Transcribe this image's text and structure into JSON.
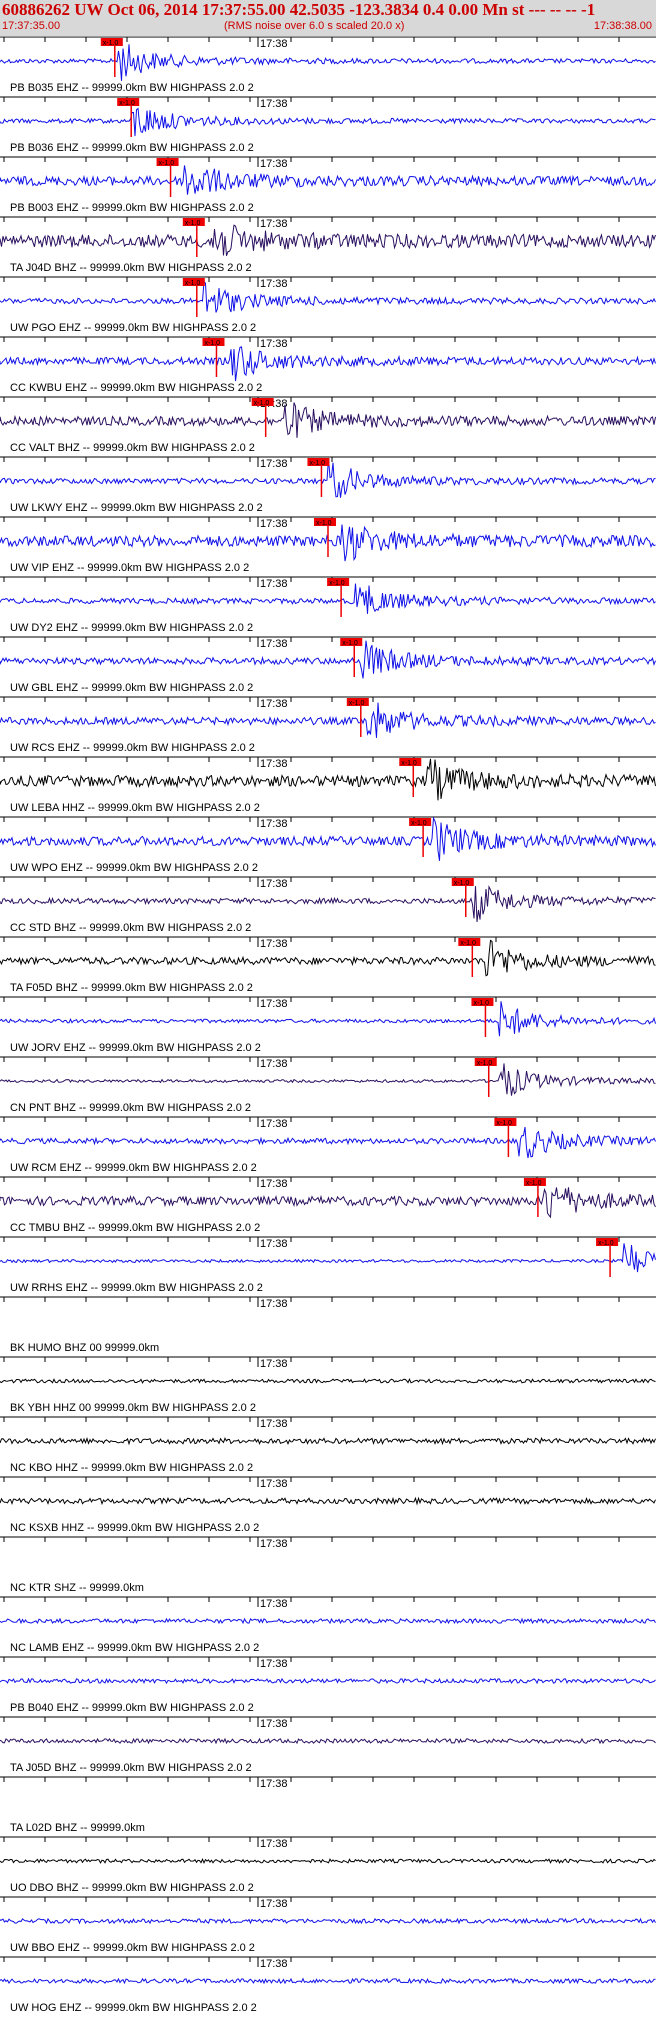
{
  "header": {
    "title": "60886262 UW Oct 06, 2014 17:37:55.00   42.5035 -123.3834  0.4 0.00 Mn st --- -- --  -1",
    "start_time": "17:37:35.00",
    "scale_note": "(RMS noise over 6.0 s scaled 20.0 x)",
    "end_time": "17:38:38.00"
  },
  "tick_label": "17:38",
  "pick_label": "x-1.0",
  "colors": {
    "header_bg": "#d8d8d8",
    "header_text": "#cc0000",
    "pick": "#ee0000",
    "blue": "#1010e8",
    "dark": "#2a1060",
    "black": "#000000"
  },
  "traces": [
    {
      "label": "PB B035 EHZ -- 99999.0km BW  HIGHPASS  2.0  2",
      "color": "blue",
      "amp": 0.12,
      "pick": 0.175,
      "event": 0.18
    },
    {
      "label": "PB B036 EHZ -- 99999.0km BW  HIGHPASS  2.0  2",
      "color": "blue",
      "amp": 0.12,
      "pick": 0.2,
      "event": 0.2
    },
    {
      "label": "PB B003 EHZ -- 99999.0km BW  HIGHPASS  2.0  2",
      "color": "blue",
      "amp": 0.25,
      "pick": 0.26,
      "event": 0.28
    },
    {
      "label": "TA J04D BHZ -- 99999.0km BW  HIGHPASS  2.0  2",
      "color": "dark",
      "amp": 0.35,
      "pick": 0.3,
      "event": 0.32
    },
    {
      "label": "UW PGO EHZ -- 99999.0km BW  HIGHPASS  2.0  2",
      "color": "blue",
      "amp": 0.15,
      "pick": 0.3,
      "event": 0.31
    },
    {
      "label": "CC KWBU EHZ -- 99999.0km BW  HIGHPASS  2.0  2",
      "color": "blue",
      "amp": 0.2,
      "pick": 0.33,
      "event": 0.35
    },
    {
      "label": "CC VALT BHZ -- 99999.0km BW  HIGHPASS  2.0  2",
      "color": "dark",
      "amp": 0.25,
      "pick": 0.405,
      "event": 0.43
    },
    {
      "label": "UW LKWY EHZ -- 99999.0km BW  HIGHPASS  2.0  2",
      "color": "blue",
      "amp": 0.15,
      "pick": 0.49,
      "event": 0.5
    },
    {
      "label": "UW VIP EHZ -- 99999.0km BW  HIGHPASS  2.0  2",
      "color": "blue",
      "amp": 0.3,
      "pick": 0.5,
      "event": 0.52
    },
    {
      "label": "UW DY2 EHZ -- 99999.0km BW  HIGHPASS  2.0  2",
      "color": "blue",
      "amp": 0.15,
      "pick": 0.52,
      "event": 0.54
    },
    {
      "label": "UW GBL EHZ -- 99999.0km BW  HIGHPASS  2.0  2",
      "color": "blue",
      "amp": 0.18,
      "pick": 0.54,
      "event": 0.55
    },
    {
      "label": "UW RCS EHZ -- 99999.0km BW  HIGHPASS  2.0  2",
      "color": "blue",
      "amp": 0.2,
      "pick": 0.55,
      "event": 0.56
    },
    {
      "label": "UW LEBA HHZ -- 99999.0km BW  HIGHPASS  2.0  2",
      "color": "black",
      "amp": 0.3,
      "pick": 0.63,
      "event": 0.65
    },
    {
      "label": "UW WPO EHZ -- 99999.0km BW  HIGHPASS  2.0  2",
      "color": "blue",
      "amp": 0.25,
      "pick": 0.645,
      "event": 0.66
    },
    {
      "label": "CC STD BHZ -- 99999.0km BW  HIGHPASS  2.0  2",
      "color": "dark",
      "amp": 0.15,
      "pick": 0.71,
      "event": 0.72
    },
    {
      "label": "TA F05D BHZ -- 99999.0km BW  HIGHPASS  2.0  2",
      "color": "black",
      "amp": 0.2,
      "pick": 0.72,
      "event": 0.74
    },
    {
      "label": "UW JORV EHZ -- 99999.0km BW  HIGHPASS  2.0  2",
      "color": "blue",
      "amp": 0.1,
      "pick": 0.74,
      "event": 0.76
    },
    {
      "label": "CN PNT BHZ -- 99999.0km BW  HIGHPASS  2.0  2",
      "color": "dark",
      "amp": 0.08,
      "pick": 0.745,
      "event": 0.76
    },
    {
      "label": "UW RCM EHZ -- 99999.0km BW  HIGHPASS  2.0  2",
      "color": "blue",
      "amp": 0.15,
      "pick": 0.775,
      "event": 0.79
    },
    {
      "label": "CC TMBU BHZ -- 99999.0km BW  HIGHPASS  2.0  2",
      "color": "dark",
      "amp": 0.25,
      "pick": 0.82,
      "event": 0.83
    },
    {
      "label": "UW RRHS EHZ -- 99999.0km BW  HIGHPASS  2.0  2",
      "color": "blue",
      "amp": 0.08,
      "pick": 0.93,
      "event": 0.95
    },
    {
      "label": "BK HUMO BHZ 00 99999.0km",
      "color": "none",
      "amp": 0,
      "pick": null,
      "event": null
    },
    {
      "label": "BK YBH HHZ 00 99999.0km BW  HIGHPASS  2.0  2",
      "color": "black",
      "amp": 0.1,
      "pick": null,
      "event": null
    },
    {
      "label": "NC KBO HHZ -- 99999.0km BW  HIGHPASS  2.0  2",
      "color": "black",
      "amp": 0.15,
      "pick": null,
      "event": null
    },
    {
      "label": "NC KSXB HHZ -- 99999.0km BW  HIGHPASS  2.0  2",
      "color": "black",
      "amp": 0.15,
      "pick": null,
      "event": null
    },
    {
      "label": "NC KTR SHZ -- 99999.0km",
      "color": "none",
      "amp": 0,
      "pick": null,
      "event": null
    },
    {
      "label": "NC LAMB EHZ -- 99999.0km BW  HIGHPASS  2.0  2",
      "color": "blue",
      "amp": 0.12,
      "pick": null,
      "event": null
    },
    {
      "label": "PB B040 EHZ -- 99999.0km BW  HIGHPASS  2.0  2",
      "color": "blue",
      "amp": 0.12,
      "pick": null,
      "event": null
    },
    {
      "label": "TA J05D BHZ -- 99999.0km BW  HIGHPASS  2.0  2",
      "color": "dark",
      "amp": 0.12,
      "pick": null,
      "event": null
    },
    {
      "label": "TA L02D BHZ -- 99999.0km",
      "color": "none",
      "amp": 0,
      "pick": null,
      "event": null
    },
    {
      "label": "UO DBO BHZ -- 99999.0km BW  HIGHPASS  2.0  2",
      "color": "black",
      "amp": 0.1,
      "pick": null,
      "event": null
    },
    {
      "label": "UW BBO EHZ -- 99999.0km BW  HIGHPASS  2.0  2",
      "color": "blue",
      "amp": 0.12,
      "pick": null,
      "event": null
    },
    {
      "label": "UW HOG EHZ -- 99999.0km BW  HIGHPASS  2.0  2",
      "color": "blue",
      "amp": 0.12,
      "pick": null,
      "event": null
    }
  ]
}
